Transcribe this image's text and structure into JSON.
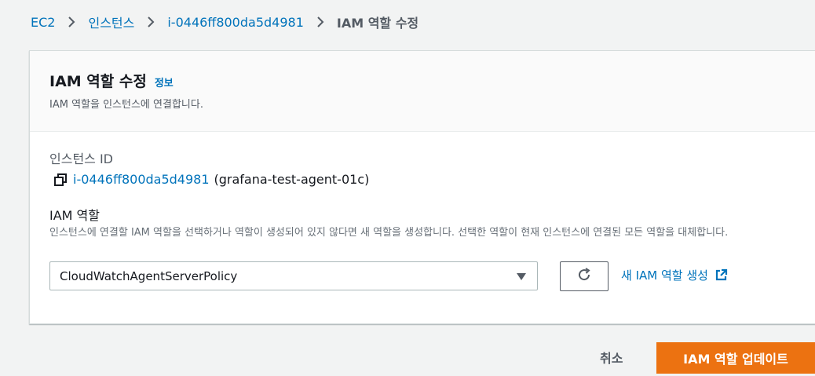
{
  "breadcrumb": {
    "items": [
      "EC2",
      "인스턴스",
      "i-0446ff800da5d4981"
    ],
    "current": "IAM 역할 수정"
  },
  "panel": {
    "title": "IAM 역할 수정",
    "info_link": "정보",
    "description": "IAM 역할을 인스턴스에 연결합니다."
  },
  "instance": {
    "label": "인스턴스 ID",
    "id": "i-0446ff800da5d4981",
    "name": "(grafana-test-agent-01c)"
  },
  "iam_role": {
    "label": "IAM 역할",
    "description": "인스턴스에 연결할 IAM 역할을 선택하거나 역할이 생성되어 있지 않다면 새 역할을 생성합니다. 선택한 역할이 현재 인스턴스에 연결된 모든 역할을 대체합니다.",
    "selected": "CloudWatchAgentServerPolicy",
    "create_link": "새 IAM 역할 생성"
  },
  "actions": {
    "cancel": "취소",
    "update": "IAM 역할 업데이트"
  },
  "colors": {
    "link": "#0073bb",
    "primary": "#ec7211",
    "background": "#f2f3f3"
  }
}
